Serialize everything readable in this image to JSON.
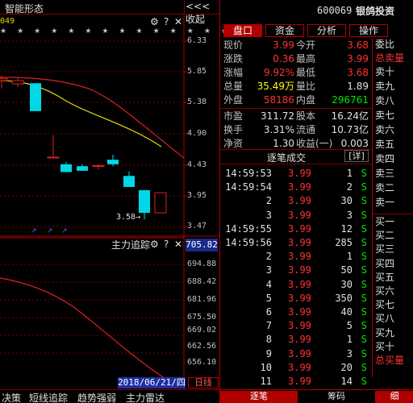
{
  "left": {
    "title": "智能形态",
    "collapse_label": "<<<收起",
    "row_label": "049",
    "yaxis_labels": [
      "6.33",
      "5.85",
      "5.38",
      "4.90",
      "4.43",
      "3.95",
      "3.47"
    ],
    "low_marker": "3.58",
    "indicator": {
      "title": "主力追踪",
      "value": "705.82",
      "yaxis_labels": [
        "694.88",
        "688.42",
        "681.96",
        "675.50",
        "669.02",
        "662.56",
        "656.10"
      ]
    },
    "date": "2018/06/21/四",
    "period_label": "日线",
    "bottom_tabs": [
      "决策",
      "短线追踪",
      "趋势强弱",
      "主力雷达"
    ],
    "candles": [
      {
        "open": 5.72,
        "close": 5.75,
        "high": 5.8,
        "low": 5.6
      },
      {
        "open": 5.67,
        "close": 5.72,
        "high": 5.76,
        "low": 5.62
      },
      {
        "open": 5.68,
        "close": 5.25,
        "high": 5.68,
        "low": 5.25
      },
      {
        "open": 4.54,
        "close": 4.54,
        "high": 4.88,
        "low": 4.54
      },
      {
        "open": 4.43,
        "close": 4.31,
        "high": 4.47,
        "low": 4.31
      },
      {
        "open": 4.4,
        "close": 4.33,
        "high": 4.43,
        "low": 4.33
      },
      {
        "open": 4.41,
        "close": 4.41,
        "high": 4.43,
        "low": 4.35
      },
      {
        "open": 4.5,
        "close": 4.43,
        "high": 4.58,
        "low": 4.4
      },
      {
        "open": 4.25,
        "close": 4.08,
        "high": 4.32,
        "low": 4.08
      },
      {
        "open": 4.03,
        "close": 3.68,
        "high": 4.03,
        "low": 3.58
      },
      {
        "open": 3.68,
        "close": 3.99,
        "high": 3.99,
        "low": 3.68
      }
    ]
  },
  "stock": {
    "code": "600069",
    "name": "银鸽投资"
  },
  "tabs": [
    "盘口",
    "资金",
    "分析",
    "操作"
  ],
  "quote": [
    {
      "l1": "现价",
      "v1": "3.99",
      "c1": "red",
      "l2": "今开",
      "v2": "3.68",
      "c2": "red"
    },
    {
      "l1": "涨跌",
      "v1": "0.36",
      "c1": "red",
      "l2": "最高",
      "v2": "3.99",
      "c2": "red"
    },
    {
      "l1": "涨幅",
      "v1": "9.92%",
      "c1": "red",
      "l2": "最低",
      "v2": "3.68",
      "c2": "red"
    },
    {
      "l1": "总量",
      "v1": "35.49万",
      "c1": "yellow",
      "l2": "量比",
      "v2": "1.89",
      "c2": "white"
    },
    {
      "l1": "外盘",
      "v1": "58186",
      "c1": "red",
      "l2": "内盘",
      "v2": "296761",
      "c2": "green"
    },
    {
      "l1": "市盈",
      "v1": "311.72",
      "c1": "white",
      "l2": "股本",
      "v2": "16.24亿",
      "c2": "white"
    },
    {
      "l1": "换手",
      "v1": "3.31%",
      "c1": "white",
      "l2": "流通",
      "v2": "10.73亿",
      "c2": "white"
    },
    {
      "l1": "净资",
      "v1": "1.30",
      "c1": "white",
      "l2": "收益(一)",
      "v2": "0.003",
      "c2": "white"
    }
  ],
  "trades_title": "逐笔成交",
  "trades_detail": "[详]",
  "trades": [
    {
      "time": "14:59:53",
      "price": "3.99",
      "vol": "1",
      "side": "S"
    },
    {
      "time": "14:59:54",
      "price": "3.99",
      "vol": "2",
      "side": "S"
    },
    {
      "time": "2",
      "price": "3.99",
      "vol": "30",
      "side": "S"
    },
    {
      "time": "3",
      "price": "3.99",
      "vol": "3",
      "side": "S"
    },
    {
      "time": "14:59:55",
      "price": "3.99",
      "vol": "12",
      "side": "S"
    },
    {
      "time": "14:59:56",
      "price": "3.99",
      "vol": "285",
      "side": "S"
    },
    {
      "time": "2",
      "price": "3.99",
      "vol": "1",
      "side": "S"
    },
    {
      "time": "3",
      "price": "3.99",
      "vol": "50",
      "side": "S"
    },
    {
      "time": "4",
      "price": "3.99",
      "vol": "30",
      "side": "S"
    },
    {
      "time": "5",
      "price": "3.99",
      "vol": "350",
      "side": "S"
    },
    {
      "time": "6",
      "price": "3.99",
      "vol": "40",
      "side": "S"
    },
    {
      "time": "7",
      "price": "3.99",
      "vol": "5",
      "side": "S"
    },
    {
      "time": "8",
      "price": "3.99",
      "vol": "1",
      "side": "S"
    },
    {
      "time": "9",
      "price": "3.99",
      "vol": "3",
      "side": "S"
    },
    {
      "time": "10",
      "price": "3.99",
      "vol": "20",
      "side": "S"
    },
    {
      "time": "11",
      "price": "3.99",
      "vol": "14",
      "side": "S"
    }
  ],
  "book": {
    "top": "委比",
    "sell_header": "总卖量",
    "sells": [
      "卖十",
      "卖九",
      "卖八",
      "卖七",
      "卖六",
      "卖五",
      "卖四",
      "卖三",
      "卖二",
      "卖一"
    ],
    "buys": [
      "买一",
      "买二",
      "买三",
      "买四",
      "买五",
      "买六",
      "买七",
      "买八",
      "买九",
      "买十"
    ],
    "buy_footer": "总买量"
  },
  "right_bottom_tabs": [
    "逐笔",
    "筹码",
    "细"
  ]
}
